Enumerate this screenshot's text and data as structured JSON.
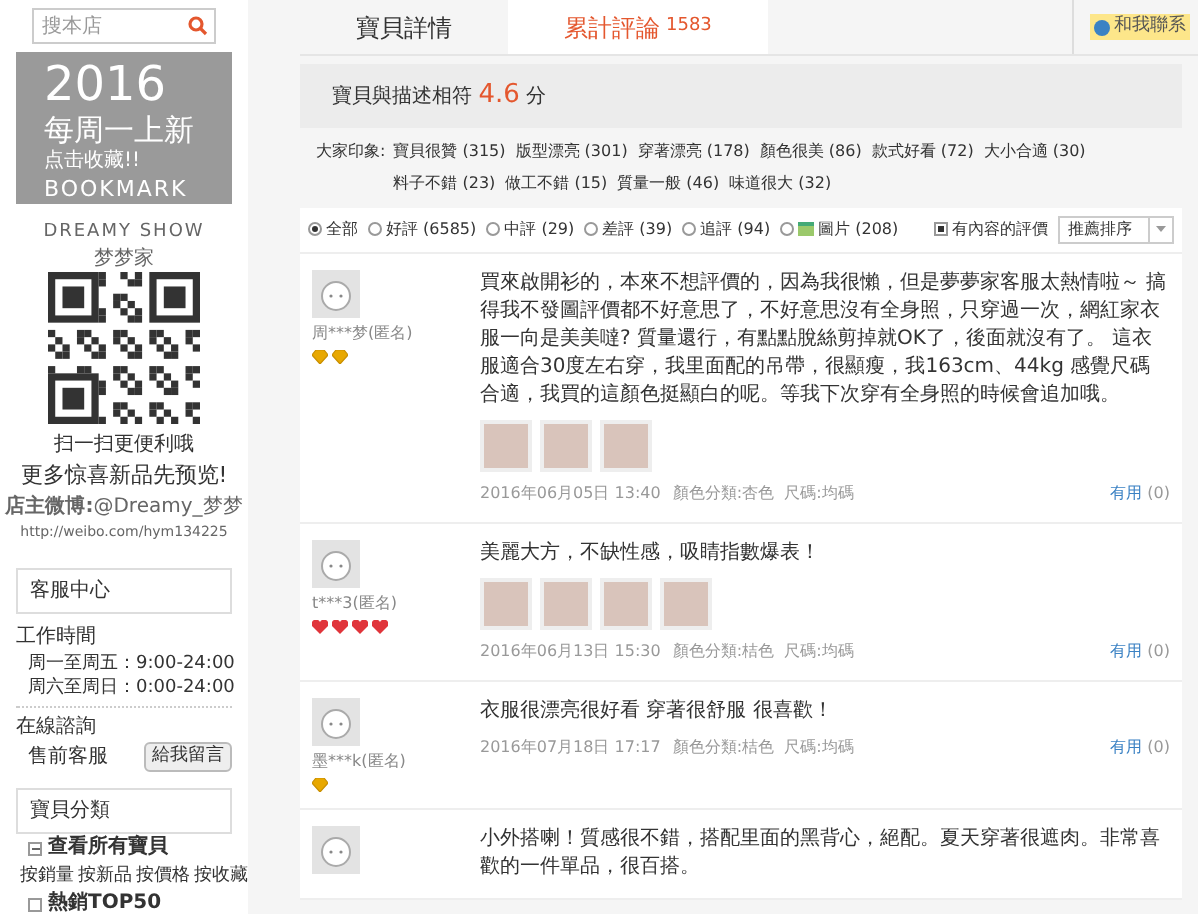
{
  "sidebar": {
    "search": {
      "placeholder": "搜本店"
    },
    "banner": {
      "year": "2016",
      "headline": "每周一上新",
      "action": "点击收藏!!",
      "word": "BOOKMARK"
    },
    "qr": {
      "brand": "DREAMY SHOW",
      "brand_cn": "梦梦家",
      "caption": "扫一扫更便利哦",
      "promo": "更多惊喜新品先预览!",
      "weibo_label": "店主微博:",
      "weibo_handle": "@Dreamy_梦梦",
      "url": "http://weibo.com/hym134225"
    },
    "service": {
      "title": "客服中心",
      "hours_title": "工作時間",
      "hours": [
        {
          "days": "周一至周五：",
          "time": "9:00-24:00"
        },
        {
          "days": "周六至周日：",
          "time": "0:00-24:00"
        }
      ],
      "consult_title": "在線諮詢",
      "consult_label": "售前客服",
      "message_button": "給我留言"
    },
    "categories": {
      "title": "寶貝分類",
      "items": [
        {
          "label": "查看所有寶貝",
          "expanded": true
        },
        {
          "kind": "links",
          "links": [
            "按銷量",
            "按新品",
            "按價格",
            "按收藏"
          ]
        },
        {
          "label": "熱銷TOP50",
          "expanded": false
        }
      ]
    }
  },
  "tabs": [
    {
      "label": "寶貝詳情",
      "selected": false
    },
    {
      "label": "累計評論",
      "count": "1583",
      "selected": true
    }
  ],
  "contact": "和我聯系",
  "rating": {
    "label": "寶貝與描述相符",
    "score": "4.6",
    "unit": "分"
  },
  "impressions": {
    "label": "大家印象:",
    "tags": [
      "寶貝很贊 (315)",
      "版型漂亮 (301)",
      "穿著漂亮 (178)",
      "顏色很美 (86)",
      "款式好看 (72)",
      "大小合適 (30)",
      "料子不錯 (23)",
      "做工不錯 (15)",
      "質量一般 (46)",
      "味道很大 (32)"
    ]
  },
  "filters": [
    {
      "label": "全部",
      "selected": true
    },
    {
      "label": "好評 (6585)",
      "selected": false
    },
    {
      "label": "中評 (29)",
      "selected": false
    },
    {
      "label": "差評 (39)",
      "selected": false
    },
    {
      "label": "追評 (94)",
      "selected": false
    },
    {
      "label": "圖片 (208)",
      "kind": "image",
      "selected": false
    }
  ],
  "content_only": {
    "label": "有內容的評價",
    "checked": true
  },
  "sort": {
    "value": "推薦排序"
  },
  "reviews": [
    {
      "user": "周***梦(匿名)",
      "badges": [
        {
          "kind": "diamond"
        },
        {
          "kind": "diamond"
        }
      ],
      "text": "買來啟開衫的，本來不想評價的，因為我很懶，但是夢夢家客服太熱情啦～ 搞得我不發圖評價都不好意思了，不好意思沒有全身照，只穿過一次，網紅家衣服一向是美美噠? 質量還行，有點點脫絲剪掉就OK了，後面就沒有了。 這衣服適合30度左右穿，我里面配的吊帶，很顯瘦，我163cm、44kg 感覺尺碼合適，我買的這顏色挺顯白的呢。等我下次穿有全身照的時候會追加哦。",
      "photos": [
        {
          "kind": "photo"
        },
        {
          "kind": "photo"
        },
        {
          "kind": "photo"
        }
      ],
      "date": "2016年06月05日 13:40",
      "spec": "顏色分類:杏色  尺碼:均碼",
      "useful": "有用",
      "useful_count": "(0)"
    },
    {
      "user": "t***3(匿名)",
      "badges": [
        {
          "kind": "heart"
        },
        {
          "kind": "heart"
        },
        {
          "kind": "heart"
        },
        {
          "kind": "heart"
        }
      ],
      "text": "美麗大方，不缺性感，吸睛指數爆表！",
      "photos": [
        {
          "kind": "photo"
        },
        {
          "kind": "photo"
        },
        {
          "kind": "photo"
        },
        {
          "kind": "photo"
        }
      ],
      "date": "2016年06月13日 15:30",
      "spec": "顏色分類:桔色  尺碼:均碼",
      "useful": "有用",
      "useful_count": "(0)"
    },
    {
      "user": "墨***k(匿名)",
      "badges": [
        {
          "kind": "diamond"
        }
      ],
      "text": "衣服很漂亮很好看 穿著很舒服 很喜歡！",
      "date": "2016年07月18日 17:17",
      "spec": "顏色分類:桔色  尺碼:均碼",
      "useful": "有用",
      "useful_count": "(0)"
    },
    {
      "text": "小外搭喇！質感很不錯，搭配里面的黑背心，絕配。夏天穿著很遮肉。非常喜歡的一件單品，很百搭。"
    }
  ]
}
